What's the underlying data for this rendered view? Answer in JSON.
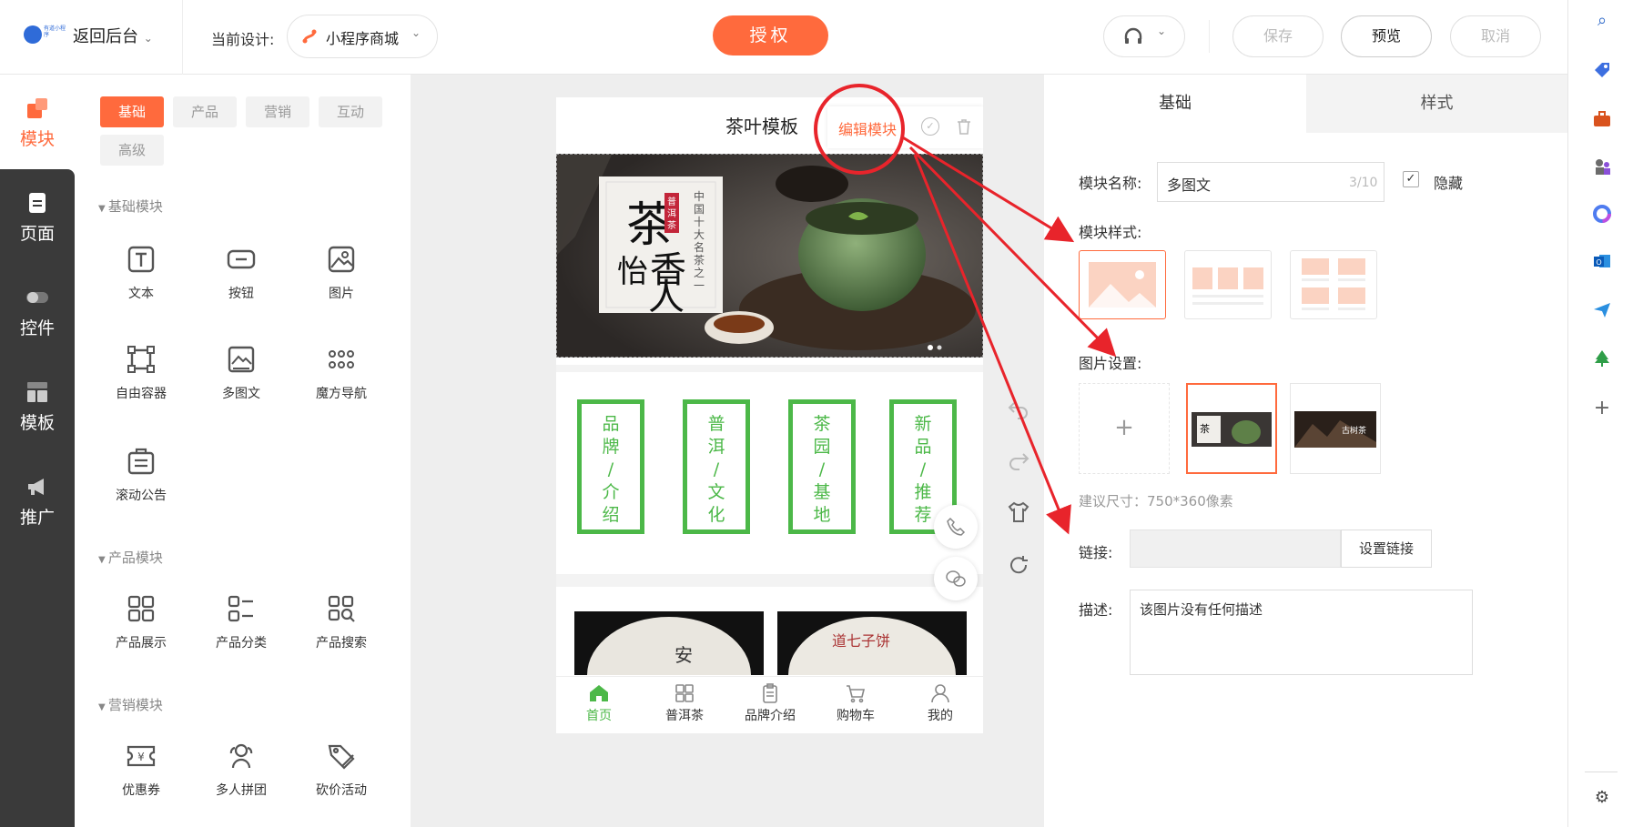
{
  "topbar": {
    "logo_text": "有道小程序",
    "back_label": "返回后台",
    "current_design_label": "当前设计:",
    "design_name": "小程序商城",
    "auth_button": "授权",
    "save_button": "保存",
    "preview_button": "预览",
    "cancel_button": "取消"
  },
  "rail": {
    "items": [
      {
        "label": "模块",
        "icon": "module-icon"
      },
      {
        "label": "页面",
        "icon": "page-icon"
      },
      {
        "label": "控件",
        "icon": "toggle-icon"
      },
      {
        "label": "模板",
        "icon": "template-icon"
      },
      {
        "label": "推广",
        "icon": "megaphone-icon"
      }
    ]
  },
  "panel": {
    "tabs": [
      "基础",
      "产品",
      "营销",
      "互动",
      "高级"
    ],
    "sections": [
      {
        "title": "基础模块",
        "modules": [
          "文本",
          "按钮",
          "图片",
          "自由容器",
          "多图文",
          "魔方导航",
          "滚动公告"
        ]
      },
      {
        "title": "产品模块",
        "modules": [
          "产品展示",
          "产品分类",
          "产品搜索"
        ]
      },
      {
        "title": "营销模块",
        "modules": [
          "优惠券",
          "多人拼团",
          "砍价活动"
        ]
      }
    ]
  },
  "phone": {
    "title": "茶叶模板",
    "edit_module": "编辑模块",
    "banner": {
      "title_chars": "茶香怡人",
      "stamp": "普洱茶",
      "vertical_text": "中国十大名茶之一"
    },
    "nav_buttons": [
      "品牌/介绍",
      "普洱/文化",
      "茶园/基地",
      "新品/推荐"
    ],
    "tabbar": [
      "首页",
      "普洱茶",
      "品牌介绍",
      "购物车",
      "我的"
    ]
  },
  "settings": {
    "tabs": [
      "基础",
      "样式"
    ],
    "module_name_label": "模块名称:",
    "module_name_value": "多图文",
    "module_name_count": "3/10",
    "hide_label": "隐藏",
    "hide_checked": true,
    "module_style_label": "模块样式:",
    "image_settings_label": "图片设置:",
    "image_add": "+",
    "image_thumb_text": "古树茶",
    "size_hint": "建议尺寸：750*360像素",
    "link_label": "链接:",
    "link_value": "",
    "set_link_button": "设置链接",
    "desc_label": "描述:",
    "desc_value": "该图片没有任何描述"
  },
  "colors": {
    "accent": "#ff6a3d",
    "green": "#4cb848",
    "annotation_red": "#e8242b",
    "rail_dark": "#3a3a3a"
  }
}
